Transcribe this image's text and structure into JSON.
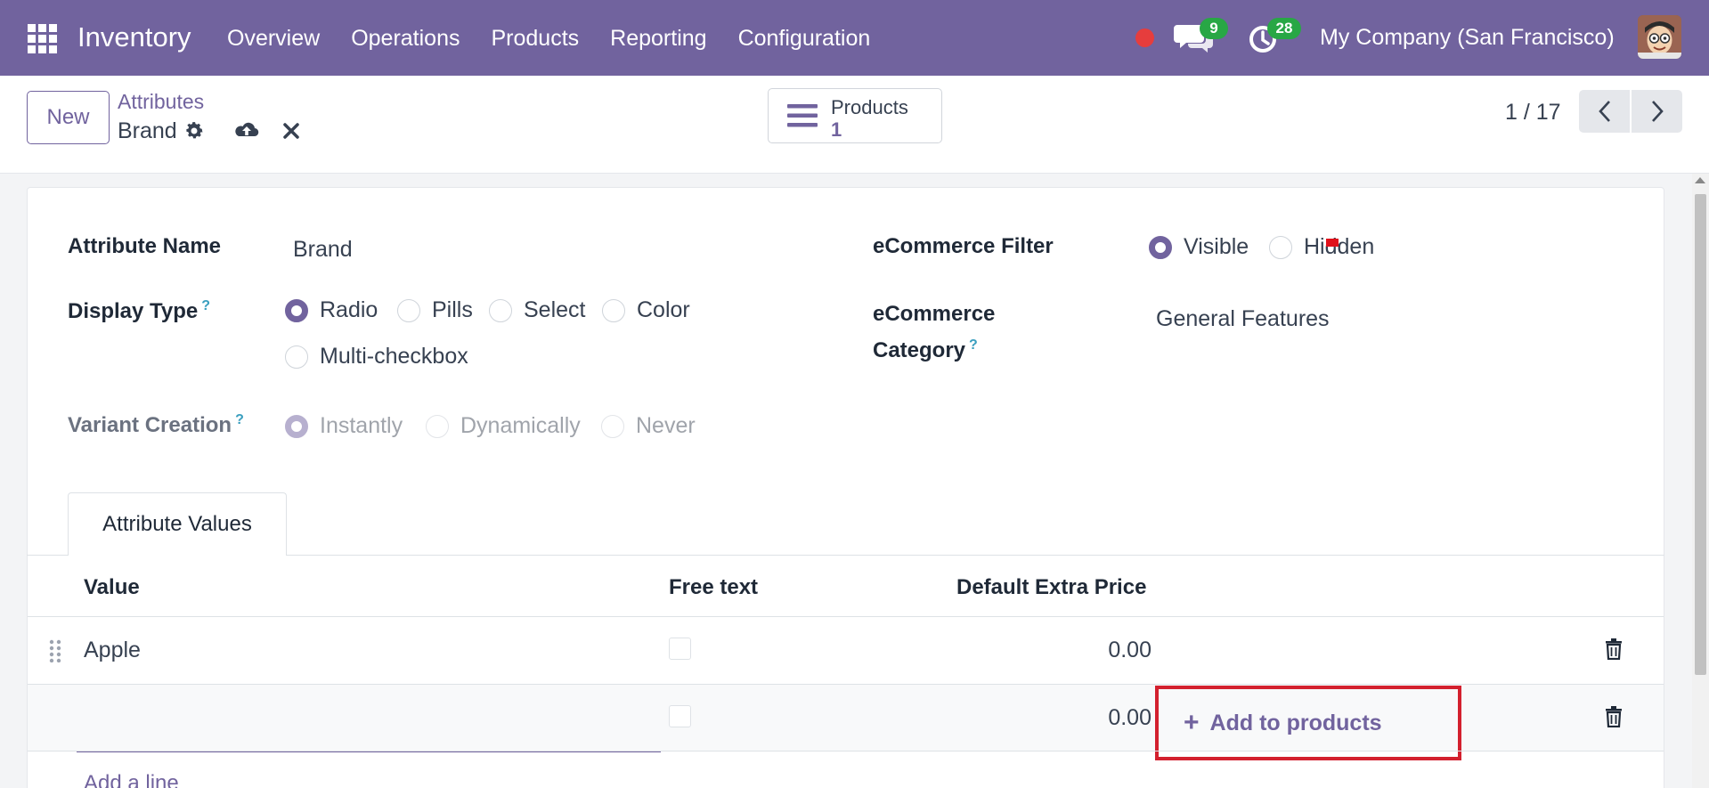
{
  "navbar": {
    "app_name": "Inventory",
    "menu": [
      "Overview",
      "Operations",
      "Products",
      "Reporting",
      "Configuration"
    ],
    "messages_count": "9",
    "activities_count": "28",
    "company": "My Company (San Francisco)",
    "accent": "#71639e"
  },
  "control": {
    "new_label": "New",
    "breadcrumb_parent": "Attributes",
    "record_name": "Brand",
    "smart_button": {
      "label": "Products",
      "count": "1"
    },
    "pager": "1 / 17"
  },
  "form": {
    "attribute_name_label": "Attribute Name",
    "attribute_name_value": "Brand",
    "display_type_label": "Display Type",
    "display_type_options": [
      "Radio",
      "Pills",
      "Select",
      "Color",
      "Multi-checkbox"
    ],
    "display_type_selected": "Radio",
    "variant_creation_label": "Variant Creation",
    "variant_creation_options": [
      "Instantly",
      "Dynamically",
      "Never"
    ],
    "variant_creation_selected": "Instantly",
    "ecommerce_filter_label": "eCommerce Filter",
    "ecommerce_filter_options": [
      "Visible",
      "Hidden"
    ],
    "ecommerce_filter_selected": "Visible",
    "ecommerce_category_label_1": "eCommerce",
    "ecommerce_category_label_2": "Category",
    "ecommerce_category_value": "General Features",
    "help_mark": "?"
  },
  "tabs": {
    "attribute_values": "Attribute Values"
  },
  "table": {
    "headers": {
      "value": "Value",
      "free_text": "Free text",
      "extra_price": "Default Extra Price"
    },
    "rows": [
      {
        "value": "Apple",
        "extra_price": "0.00"
      },
      {
        "value": "",
        "extra_price": "0.00"
      }
    ],
    "add_to_products": "Add to products",
    "add_line": "Add a line"
  }
}
